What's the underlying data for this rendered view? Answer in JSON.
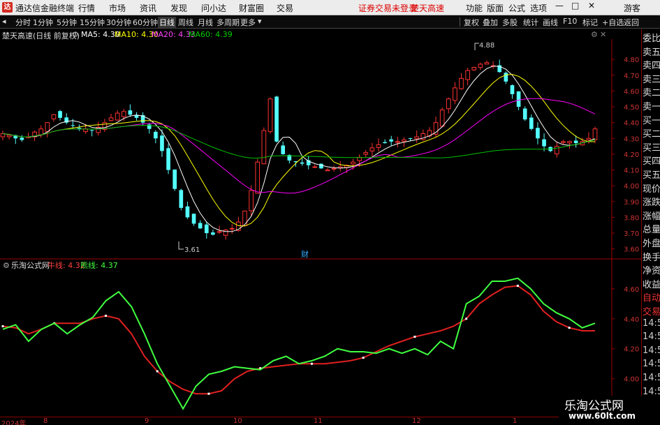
{
  "titlebar": {
    "app_name": "通达信金融终端",
    "menus": [
      "行情",
      "市场",
      "资讯",
      "发现",
      "问小达",
      "财富圈",
      "交易"
    ],
    "status": "证券交易未登录",
    "stock": "楚天高速",
    "right_menus": [
      "功能",
      "版面",
      "公式",
      "选项"
    ],
    "guest": "游客"
  },
  "toolbar": {
    "periods": [
      "分时",
      "1分钟",
      "5分钟",
      "15分钟",
      "30分钟",
      "60分钟",
      "日线",
      "周线",
      "月线",
      "多周期",
      "更多"
    ],
    "selected": "日线",
    "right_items": [
      "复权",
      "叠加",
      "多股",
      "统计",
      "画线",
      "F10",
      "标记",
      "+自选",
      "返回"
    ]
  },
  "main_legend": {
    "title": "楚天高速(日线 前复权)",
    "ma5": "MA5: 4.30",
    "ma10": "MA10: 4.30",
    "ma20": "MA20: 4.33",
    "ma60": "MA60: 4.39"
  },
  "sub_legend": {
    "name": "乐淘公式网",
    "bull": "牛线: 4.32",
    "bear": "熊线: 4.37"
  },
  "annotations": {
    "high": "4.88",
    "low": "3.61",
    "cai": "财"
  },
  "price_ticks": [
    "4.80",
    "4.70",
    "4.60",
    "4.50",
    "4.40",
    "4.30",
    "4.20",
    "4.10",
    "4.00",
    "3.90",
    "3.80",
    "3.70",
    "3.60"
  ],
  "sub_ticks": [
    "4.60",
    "4.40",
    "4.20",
    "4.00"
  ],
  "side_labels": [
    "委比",
    "卖五",
    "卖四",
    "卖三",
    "卖二",
    "卖一",
    "买一",
    "买二",
    "买三",
    "买四",
    "买五",
    "现价",
    "涨跌",
    "涨幅",
    "总量",
    "外盘",
    "换手",
    "净资",
    "收益",
    "自动",
    "交易",
    "14:56",
    "14:56",
    "14:56",
    "14:56",
    "14:56",
    "14:56",
    "14:56",
    "14:56"
  ],
  "dates": [
    "2024年",
    "8",
    "9",
    "10",
    "11",
    "12",
    "1"
  ],
  "watermark": {
    "title": "乐淘公式网",
    "url": "www.60lt.com"
  },
  "colors": {
    "up": "#ff3232",
    "down": "#54ffff",
    "ma5": "#ffffff",
    "ma10": "#ffff00",
    "ma20": "#ff00ff",
    "ma60": "#00c000",
    "bull": "#e02020",
    "bear": "#40ff40"
  },
  "chart_data": [
    {
      "type": "candlestick",
      "title": "楚天高速(日线 前复权)",
      "ylim": [
        3.55,
        4.92
      ],
      "y_ticks": [
        3.6,
        3.7,
        3.8,
        3.9,
        4.0,
        4.1,
        4.2,
        4.3,
        4.4,
        4.5,
        4.6,
        4.7,
        4.8
      ],
      "x_labels": [
        "2024年",
        "8",
        "9",
        "10",
        "11",
        "12",
        "1"
      ],
      "close_series": [
        4.33,
        4.32,
        4.3,
        4.29,
        4.31,
        4.34,
        4.36,
        4.4,
        4.45,
        4.43,
        4.4,
        4.38,
        4.36,
        4.36,
        4.35,
        4.37,
        4.4,
        4.43,
        4.46,
        4.47,
        4.45,
        4.43,
        4.4,
        4.36,
        4.3,
        4.22,
        4.1,
        3.98,
        3.86,
        3.8,
        3.76,
        3.73,
        3.7,
        3.69,
        3.71,
        3.72,
        3.73,
        3.77,
        3.84,
        3.97,
        4.15,
        4.35,
        4.55,
        4.28,
        4.2,
        4.16,
        4.15,
        4.14,
        4.13,
        4.12,
        4.11,
        4.1,
        4.11,
        4.12,
        4.13,
        4.15,
        4.18,
        4.21,
        4.24,
        4.26,
        4.27,
        4.28,
        4.28,
        4.29,
        4.3,
        4.31,
        4.33,
        4.35,
        4.4,
        4.48,
        4.55,
        4.62,
        4.68,
        4.73,
        4.75,
        4.77,
        4.78,
        4.76,
        4.72,
        4.66,
        4.58,
        4.5,
        4.42,
        4.36,
        4.3,
        4.25,
        4.22,
        4.25,
        4.28,
        4.28,
        4.27,
        4.28,
        4.3,
        4.36
      ],
      "series": [
        {
          "name": "MA5",
          "last": 4.3
        },
        {
          "name": "MA10",
          "last": 4.3
        },
        {
          "name": "MA20",
          "last": 4.33
        },
        {
          "name": "MA60",
          "last": 4.39
        }
      ],
      "annotations": [
        {
          "text": "4.88",
          "y": 4.88
        },
        {
          "text": "3.61",
          "y": 3.61
        }
      ]
    },
    {
      "type": "line",
      "ylim": [
        3.78,
        4.72
      ],
      "y_ticks": [
        4.0,
        4.2,
        4.4,
        4.6
      ],
      "series": [
        {
          "name": "牛线",
          "last": 4.32,
          "values": [
            4.35,
            4.34,
            4.3,
            4.33,
            4.37,
            4.37,
            4.37,
            4.4,
            4.42,
            4.4,
            4.3,
            4.15,
            4.05,
            3.98,
            3.93,
            3.9,
            3.9,
            3.92,
            4.0,
            4.05,
            4.07,
            4.08,
            4.09,
            4.1,
            4.1,
            4.1,
            4.11,
            4.12,
            4.14,
            4.18,
            4.22,
            4.25,
            4.28,
            4.3,
            4.32,
            4.35,
            4.4,
            4.5,
            4.56,
            4.61,
            4.62,
            4.56,
            4.45,
            4.38,
            4.34,
            4.32,
            4.32
          ]
        },
        {
          "name": "熊线",
          "last": 4.37,
          "values": [
            4.33,
            4.36,
            4.25,
            4.33,
            4.37,
            4.3,
            4.36,
            4.41,
            4.52,
            4.58,
            4.48,
            4.3,
            4.1,
            3.95,
            3.8,
            3.95,
            4.03,
            4.05,
            4.08,
            4.07,
            4.06,
            4.12,
            4.15,
            4.1,
            4.12,
            4.15,
            4.2,
            4.18,
            4.18,
            4.17,
            4.2,
            4.17,
            4.2,
            4.16,
            4.25,
            4.2,
            4.5,
            4.55,
            4.65,
            4.65,
            4.67,
            4.6,
            4.5,
            4.44,
            4.4,
            4.34,
            4.37
          ]
        }
      ]
    }
  ]
}
